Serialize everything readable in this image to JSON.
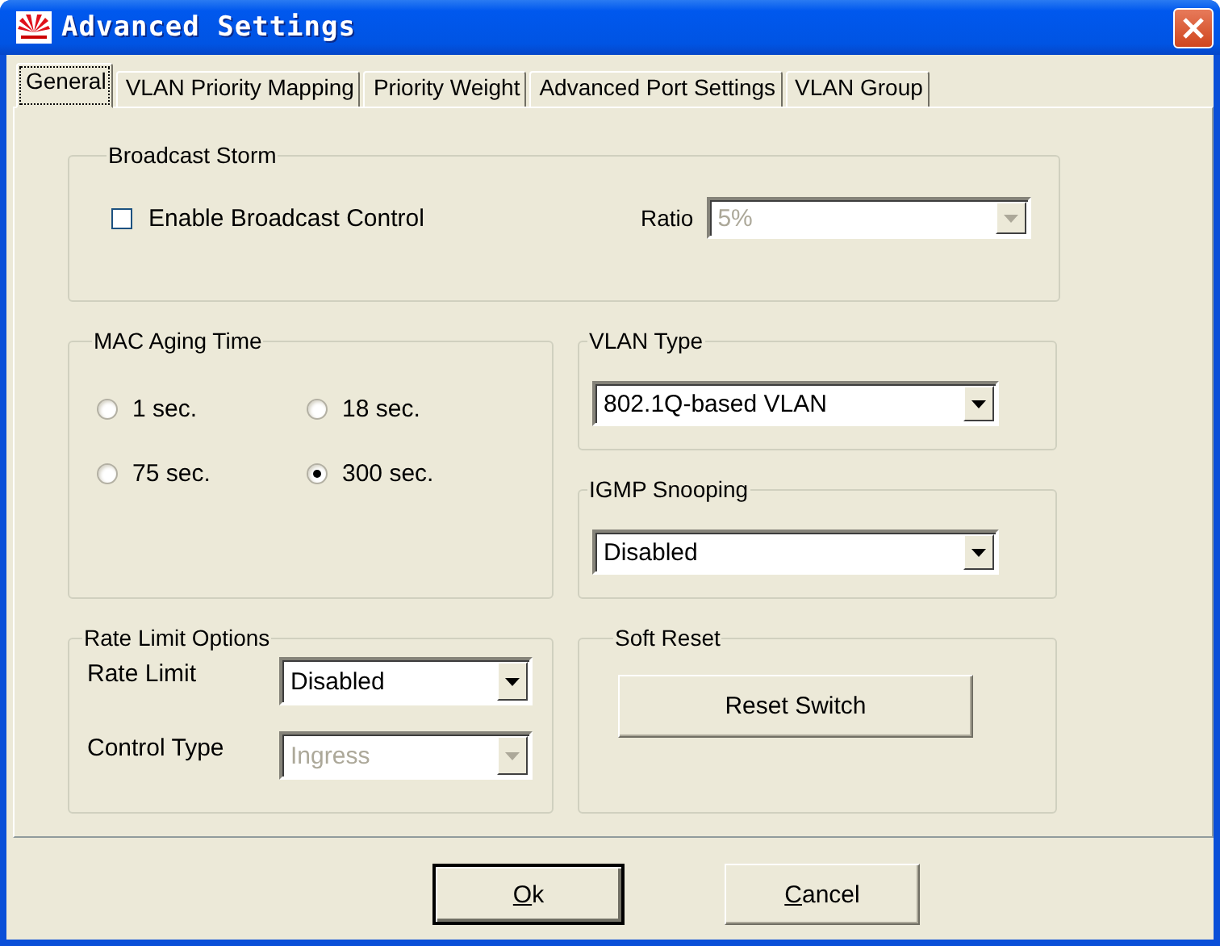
{
  "window": {
    "title": "Advanced Settings"
  },
  "tabs": [
    {
      "label": "General",
      "selected": true
    },
    {
      "label": "VLAN Priority Mapping",
      "selected": false
    },
    {
      "label": "Priority Weight",
      "selected": false
    },
    {
      "label": "Advanced Port Settings",
      "selected": false
    },
    {
      "label": "VLAN Group",
      "selected": false
    }
  ],
  "broadcast_storm": {
    "title": "Broadcast Storm",
    "enable_checkbox": {
      "label": "Enable Broadcast Control",
      "checked": false
    },
    "ratio": {
      "label": "Ratio",
      "value": "5%",
      "disabled": true
    }
  },
  "mac_aging_time": {
    "title": "MAC Aging Time",
    "options": [
      {
        "label": "1 sec.",
        "selected": false
      },
      {
        "label": "18 sec.",
        "selected": false
      },
      {
        "label": "75 sec.",
        "selected": false
      },
      {
        "label": "300 sec.",
        "selected": true
      }
    ]
  },
  "vlan_type": {
    "title": "VLAN Type",
    "value": "802.1Q-based VLAN",
    "disabled": false
  },
  "igmp_snooping": {
    "title": "IGMP Snooping",
    "value": "Disabled",
    "disabled": false
  },
  "rate_limit_options": {
    "title": "Rate Limit Options",
    "fields": [
      {
        "label": "Rate Limit",
        "value": "Disabled",
        "disabled": false
      },
      {
        "label": "Control Type",
        "value": "Ingress",
        "disabled": true
      }
    ]
  },
  "soft_reset": {
    "title": "Soft Reset",
    "button": "Reset Switch"
  },
  "buttons": [
    {
      "label": "Ok",
      "underline_first": true,
      "default": true
    },
    {
      "label": "Cancel",
      "underline_first": true,
      "default": false
    }
  ]
}
